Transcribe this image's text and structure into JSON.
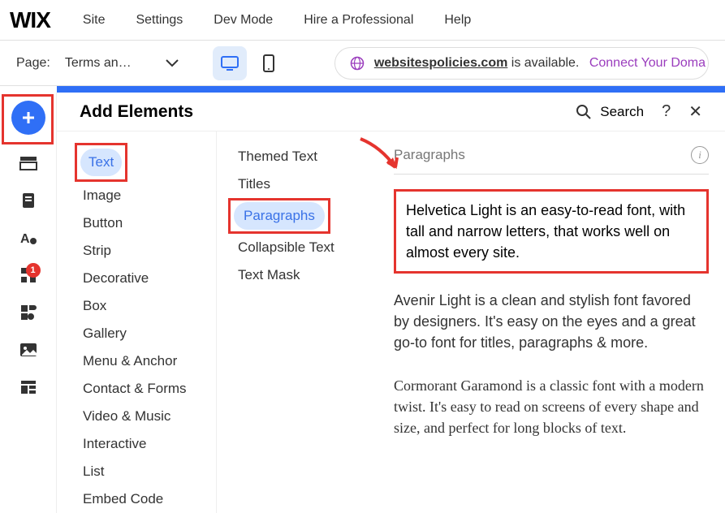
{
  "logo": "WIX",
  "topnav": [
    "Site",
    "Settings",
    "Dev Mode",
    "Hire a Professional",
    "Help"
  ],
  "secondbar": {
    "page_label": "Page:",
    "page_name": "Terms an…",
    "domain_name": "websitespolicies.com",
    "domain_suffix": " is available.",
    "connect": "Connect Your Doma"
  },
  "leftrail": {
    "badge_count": "1"
  },
  "panel": {
    "title": "Add Elements",
    "search": "Search",
    "help": "?",
    "close": "✕"
  },
  "categories": [
    "Text",
    "Image",
    "Button",
    "Strip",
    "Decorative",
    "Box",
    "Gallery",
    "Menu & Anchor",
    "Contact & Forms",
    "Video & Music",
    "Interactive",
    "List",
    "Embed Code"
  ],
  "subcategories": [
    "Themed Text",
    "Titles",
    "Paragraphs",
    "Collapsible Text",
    "Text Mask"
  ],
  "preview": {
    "heading": "Paragraphs",
    "info": "i",
    "samples": [
      "Helvetica Light is an easy-to-read font, with tall and narrow letters, that works well on almost every site.",
      "Avenir Light is a clean and stylish font favored by designers. It's easy on the eyes and a great go-to font for titles, paragraphs & more.",
      "Cormorant Garamond is a classic font with a modern twist. It's easy to read on screens of every shape and size, and perfect for long blocks of text."
    ]
  }
}
